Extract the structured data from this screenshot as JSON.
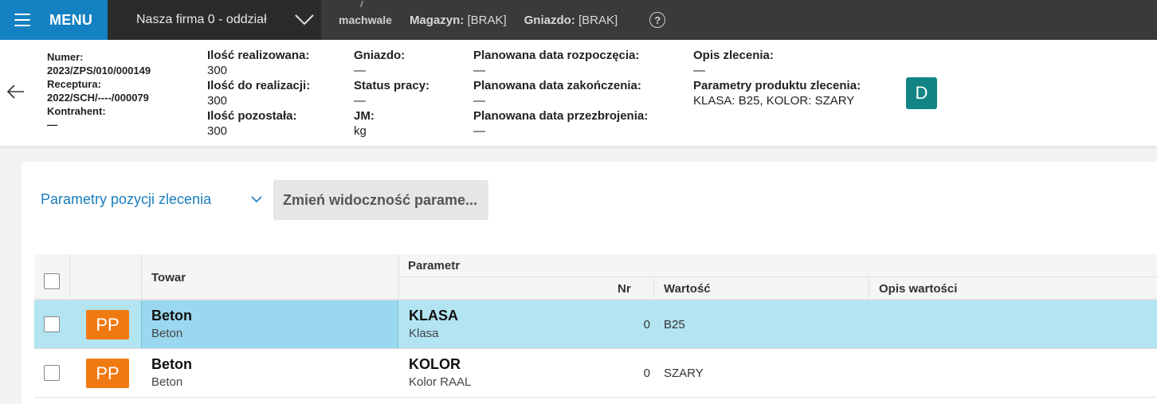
{
  "topbar": {
    "menu_label": "MENU",
    "company": "Nasza firma 0 - oddział",
    "user": "machwale",
    "magazyn_label": "Magazyn:",
    "magazyn_value": "[BRAK]",
    "gniazdo_label": "Gniazdo:",
    "gniazdo_value": "[BRAK]",
    "help": "?"
  },
  "header": {
    "numer_label": "Numer:",
    "numer_value": "2023/ZPS/010/000149",
    "receptura_label": "Receptura:",
    "receptura_value": "2022/SCH/----/000079",
    "kontrahent_label": "Kontrahent:",
    "kontrahent_value": "—",
    "ilosc_realizowana_label": "Ilość realizowana:",
    "ilosc_realizowana_value": "300",
    "ilosc_do_realizacji_label": "Ilość do realizacji:",
    "ilosc_do_realizacji_value": "300",
    "ilosc_pozostala_label": "Ilość pozostała:",
    "ilosc_pozostala_value": "300",
    "gniazdo_label": "Gniazdo:",
    "gniazdo_value": "—",
    "status_label": "Status pracy:",
    "status_value": "—",
    "jm_label": "JM:",
    "jm_value": "kg",
    "plan_start_label": "Planowana data rozpoczęcia:",
    "plan_start_value": "—",
    "plan_end_label": "Planowana data zakończenia:",
    "plan_end_value": "—",
    "plan_change_label": "Planowana data przezbrojenia:",
    "plan_change_value": "—",
    "opis_label": "Opis zlecenia:",
    "opis_value": "—",
    "param_label": "Parametry produktu zlecenia:",
    "param_value": "KLASA: B25, KOLOR: SZARY",
    "badge": "D"
  },
  "panel": {
    "title": "Parametry pozycji zlecenia",
    "visibility_button": "Zmień widoczność parame..."
  },
  "table": {
    "col_towar": "Towar",
    "col_parametr": "Parametr",
    "col_nr": "Nr",
    "col_wartosc": "Wartość",
    "col_opis": "Opis wartości",
    "rows": [
      {
        "badge": "PP",
        "towar": "Beton",
        "towar_sub": "Beton",
        "param": "KLASA",
        "param_sub": "Klasa",
        "nr": "0",
        "wartosc": "B25",
        "opis": ""
      },
      {
        "badge": "PP",
        "towar": "Beton",
        "towar_sub": "Beton",
        "param": "KOLOR",
        "param_sub": "Kolor RAAL",
        "nr": "0",
        "wartosc": "SZARY",
        "opis": ""
      }
    ]
  },
  "colors": {
    "menu_blue": "#1381c2",
    "teal_badge": "#138486",
    "orange_badge": "#f07a12",
    "selected_row": "#b2e4f2",
    "link_blue": "#1a7dbd"
  }
}
